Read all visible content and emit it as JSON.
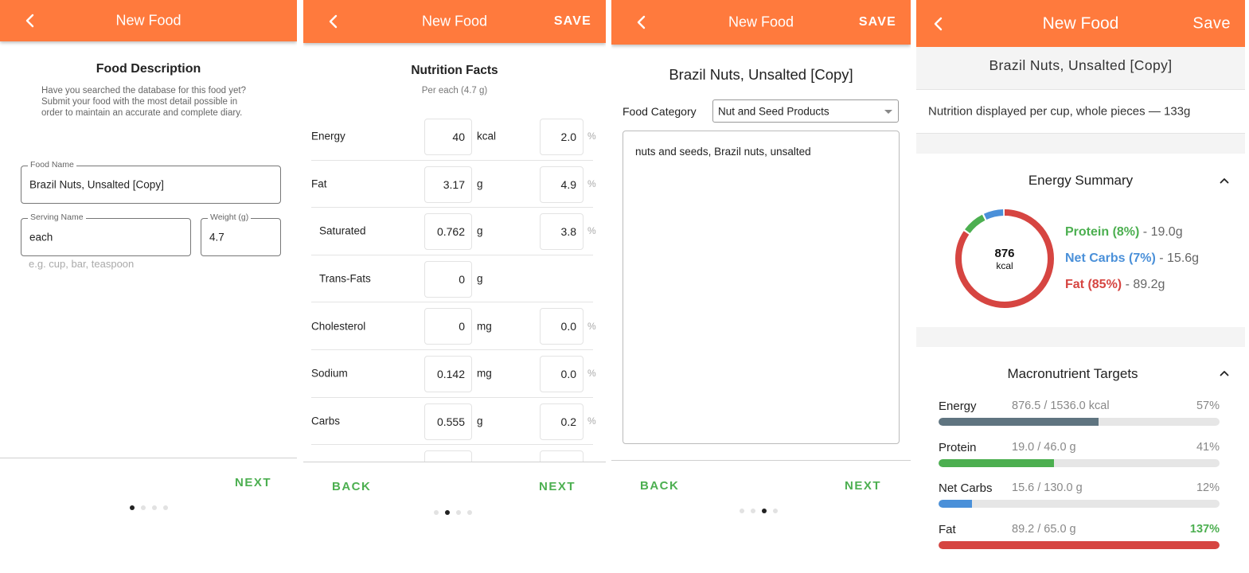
{
  "colors": {
    "appbar": "#ff7a3d",
    "accent_green": "#4caf50",
    "protein": "#4caf50",
    "net_carbs": "#4a90d9",
    "fat": "#d64541",
    "energy_bar": "#5f7480"
  },
  "icons": {
    "back": "chevron-left-icon",
    "collapse": "chevron-up-icon",
    "dropdown": "caret-down-icon"
  },
  "screen1": {
    "appbar": {
      "title": "New Food"
    },
    "heading": "Food Description",
    "description": "Have you searched the database for this food yet?  Submit your food with the most detail possible in order to maintain an accurate and complete diary.",
    "food_name": {
      "label": "Food Name",
      "value": "Brazil Nuts, Unsalted [Copy]"
    },
    "serving_name": {
      "label": "Serving Name",
      "value": "each",
      "hint": "e.g. cup, bar, teaspoon"
    },
    "weight": {
      "label": "Weight (g)",
      "value": "4.7"
    },
    "next_label": "NEXT",
    "page_index": 0,
    "page_count": 4
  },
  "screen2": {
    "appbar": {
      "title": "New Food",
      "action": "SAVE"
    },
    "heading": "Nutrition Facts",
    "subheading": "Per each (4.7 g)",
    "rows": [
      {
        "name": "Energy",
        "value": "40",
        "unit": "kcal",
        "percent": "2.0",
        "sub": false
      },
      {
        "name": "Fat",
        "value": "3.17",
        "unit": "g",
        "percent": "4.9",
        "sub": false
      },
      {
        "name": "Saturated",
        "value": "0.762",
        "unit": "g",
        "percent": "3.8",
        "sub": true
      },
      {
        "name": "Trans-Fats",
        "value": "0",
        "unit": "g",
        "percent": null,
        "sub": true
      },
      {
        "name": "Cholesterol",
        "value": "0",
        "unit": "mg",
        "percent": "0.0",
        "sub": false
      },
      {
        "name": "Sodium",
        "value": "0.142",
        "unit": "mg",
        "percent": "0.0",
        "sub": false
      },
      {
        "name": "Carbs",
        "value": "0.555",
        "unit": "g",
        "percent": "0.2",
        "sub": false
      },
      {
        "name": "",
        "value": "",
        "unit": "",
        "percent": "",
        "sub": false
      }
    ],
    "percent_symbol": "%",
    "back_label": "BACK",
    "next_label": "NEXT",
    "page_index": 1,
    "page_count": 4
  },
  "screen3": {
    "appbar": {
      "title": "New Food",
      "action": "SAVE"
    },
    "heading": "Brazil Nuts, Unsalted [Copy]",
    "category_label": "Food Category",
    "category_value": "Nut and Seed Products",
    "description_value": "nuts and seeds, Brazil nuts, unsalted",
    "back_label": "BACK",
    "next_label": "NEXT",
    "page_index": 2,
    "page_count": 4
  },
  "screen4": {
    "appbar": {
      "title": "New Food",
      "action": "Save"
    },
    "food_name": "Brazil Nuts, Unsalted [Copy]",
    "serving_text": "Nutrition displayed per cup, whole pieces  — 133g",
    "energy_summary": {
      "title": "Energy Summary",
      "kcal_value": "876",
      "kcal_unit": "kcal",
      "segments": [
        {
          "name": "Fat (85%)",
          "value": " - 89.2g",
          "fraction": 0.85,
          "color": "#d64541"
        },
        {
          "name": "Protein (8%)",
          "value": " - 19.0g",
          "fraction": 0.08,
          "color": "#4caf50"
        },
        {
          "name": "Net Carbs (7%)",
          "value": " - 15.6g",
          "fraction": 0.07,
          "color": "#4a90d9"
        }
      ],
      "legend": [
        {
          "name": "Protein (8%)",
          "value": " - 19.0g",
          "color": "#4caf50"
        },
        {
          "name": "Net Carbs (7%)",
          "value": " - 15.6g",
          "color": "#4a90d9"
        },
        {
          "name": "Fat (85%)",
          "value": " - 89.2g",
          "color": "#d64541"
        }
      ]
    },
    "macro_targets": {
      "title": "Macronutrient Targets",
      "rows": [
        {
          "name": "Energy",
          "amount": "876.5 / 1536.0 kcal",
          "percent": "57%",
          "fraction": 0.57,
          "color": "#5f7480",
          "over": false
        },
        {
          "name": "Protein",
          "amount": "19.0 / 46.0 g",
          "percent": "41%",
          "fraction": 0.41,
          "color": "#4caf50",
          "over": false
        },
        {
          "name": "Net Carbs",
          "amount": "15.6 / 130.0 g",
          "percent": "12%",
          "fraction": 0.12,
          "color": "#4a90d9",
          "over": false
        },
        {
          "name": "Fat",
          "amount": "89.2 / 65.0 g",
          "percent": "137%",
          "fraction": 1.0,
          "color": "#d64541",
          "over": true
        }
      ]
    }
  }
}
